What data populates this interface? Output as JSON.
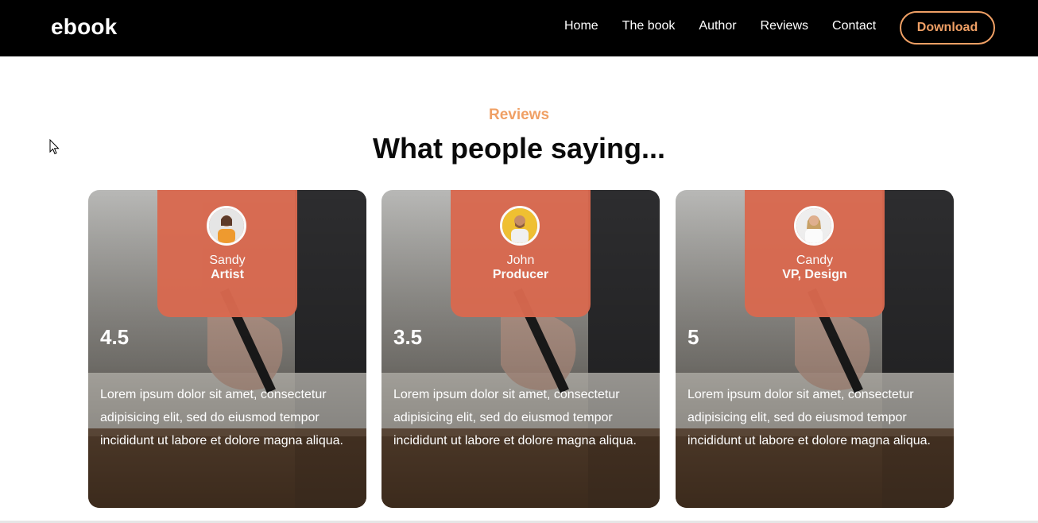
{
  "header": {
    "brand": "ebook",
    "nav": [
      "Home",
      "The book",
      "Author",
      "Reviews",
      "Contact"
    ],
    "download_label": "Download"
  },
  "section": {
    "subtitle": "Reviews",
    "title": "What people saying..."
  },
  "reviews": [
    {
      "name": "Sandy",
      "role": "Artist",
      "rating": "4.5",
      "text": "Lorem ipsum dolor sit amet, consectetur adipisicing elit, sed do eiusmod tempor incididunt ut labore et dolore magna aliqua.",
      "avatar_bg": "#e8e8e8",
      "shirt": "#f29a2b"
    },
    {
      "name": "John",
      "role": "Producer",
      "rating": "3.5",
      "text": "Lorem ipsum dolor sit amet, consectetur adipisicing elit, sed do eiusmod tempor incididunt ut labore et dolore magna aliqua.",
      "avatar_bg": "#f2c12e",
      "shirt": "#f4f4f4"
    },
    {
      "name": "Candy",
      "role": "VP, Design",
      "rating": "5",
      "text": "Lorem ipsum dolor sit amet, consectetur adipisicing elit, sed do eiusmod tempor incididunt ut labore et dolore magna aliqua.",
      "avatar_bg": "#f1f1f1",
      "shirt": "#ffffff"
    }
  ],
  "colors": {
    "accent": "#f0a065",
    "card_top": "#d9694f",
    "navbar": "#000000"
  }
}
